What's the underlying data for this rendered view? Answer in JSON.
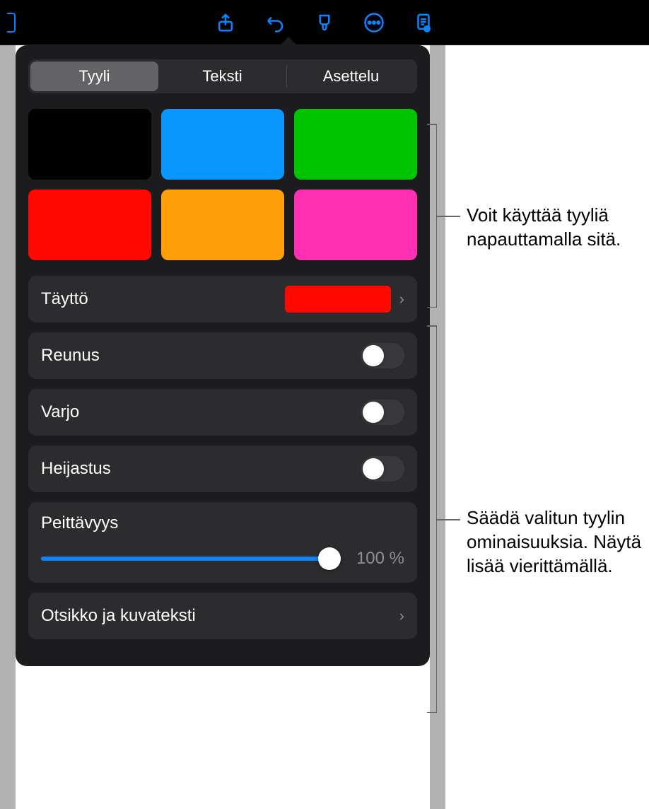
{
  "toolbar": {
    "icons": [
      "share-icon",
      "undo-icon",
      "brush-icon",
      "more-icon",
      "document-icon"
    ]
  },
  "tabs": {
    "style": "Tyyli",
    "text": "Teksti",
    "layout": "Asettelu",
    "selected": "style"
  },
  "swatches": [
    {
      "name": "black",
      "color": "#000000"
    },
    {
      "name": "blue",
      "color": "#0a96ff"
    },
    {
      "name": "green",
      "color": "#00c400"
    },
    {
      "name": "red",
      "color": "#ff0800"
    },
    {
      "name": "orange",
      "color": "#ff9f0a"
    },
    {
      "name": "magenta",
      "color": "#ff2fb2"
    }
  ],
  "fill": {
    "label": "Täyttö",
    "color": "#ff0800"
  },
  "border": {
    "label": "Reunus",
    "on": false
  },
  "shadow": {
    "label": "Varjo",
    "on": false
  },
  "reflection": {
    "label": "Heijastus",
    "on": false
  },
  "opacity": {
    "label": "Peittävyys",
    "value": "100 %",
    "percent": 100
  },
  "titlecaption": {
    "label": "Otsikko ja kuvateksti"
  },
  "callouts": {
    "top": "Voit käyttää tyyliä napauttamalla sitä.",
    "bottom_l1": "Säädä valitun tyylin",
    "bottom_l2": "ominaisuuksia. Näytä",
    "bottom_l3": "lisää vierittämällä."
  }
}
